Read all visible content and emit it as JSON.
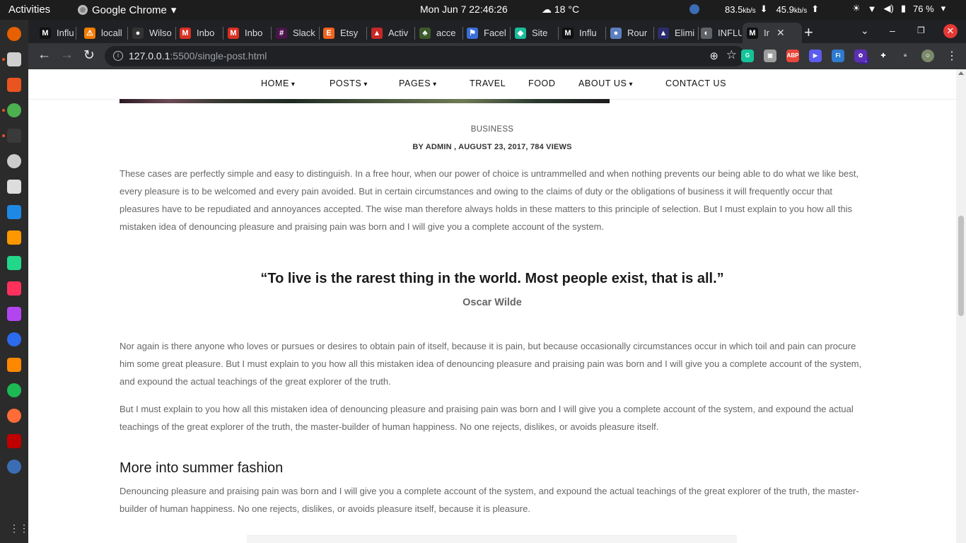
{
  "system_bar": {
    "activities": "Activities",
    "app_name": "Google Chrome",
    "datetime": "Mon Jun 7  22:46:26",
    "weather": "18 °C",
    "down_speed": "83.5",
    "down_unit": "kb/s",
    "up_speed": "45.9",
    "up_unit": "kb/s",
    "battery": "76 %"
  },
  "tabs": [
    {
      "label": "Influ",
      "icon": "medium-icon",
      "color": "#111111",
      "glyph": "M"
    },
    {
      "label": "locall",
      "icon": "xampp-icon",
      "color": "#f57c00",
      "glyph": "⚠"
    },
    {
      "label": "Wilso",
      "icon": "github-icon",
      "color": "#333333",
      "glyph": "●"
    },
    {
      "label": "Inbo",
      "icon": "gmail-icon",
      "color": "#d93025",
      "glyph": "M"
    },
    {
      "label": "Inbo",
      "icon": "gmail-icon",
      "color": "#d93025",
      "glyph": "M"
    },
    {
      "label": "Slack",
      "icon": "slack-icon",
      "color": "#4a154b",
      "glyph": "#"
    },
    {
      "label": "Etsy",
      "icon": "etsy-icon",
      "color": "#f1641e",
      "glyph": "E"
    },
    {
      "label": "Activ",
      "icon": "lock-icon",
      "color": "#c62828",
      "glyph": "▲"
    },
    {
      "label": "acce",
      "icon": "tree-icon",
      "color": "#3b5a2a",
      "glyph": "♣"
    },
    {
      "label": "Facel",
      "icon": "flag-icon",
      "color": "#3b6fd8",
      "glyph": "⚑"
    },
    {
      "label": "Site",
      "icon": "diamond-icon",
      "color": "#1abc9c",
      "glyph": "◆"
    },
    {
      "label": "Influ",
      "icon": "medium-icon",
      "color": "#111111",
      "glyph": "M"
    },
    {
      "label": "Rour",
      "icon": "globe-icon",
      "color": "#5b7fbf",
      "glyph": "●"
    },
    {
      "label": "Elimi",
      "icon": "hat-icon",
      "color": "#2c2c6c",
      "glyph": "▲"
    },
    {
      "label": "INFLU",
      "icon": "globe-icon",
      "color": "#5f6368",
      "glyph": "◐"
    },
    {
      "label": "Ir",
      "icon": "medium-icon",
      "color": "#111111",
      "glyph": "M",
      "active": true
    }
  ],
  "address_bar": {
    "host": "127.0.0.1",
    "path": ":5500/single-post.html"
  },
  "extensions": [
    {
      "name": "grammarly-icon",
      "label": "G",
      "color": "#15c39a"
    },
    {
      "name": "extension-gray-icon",
      "label": "▣",
      "color": "#9e9e9e"
    },
    {
      "name": "adblock-plus-icon",
      "label": "ABP",
      "color": "#e8473b"
    },
    {
      "name": "zoom-icon",
      "label": "▶",
      "color": "#5c5cf0"
    },
    {
      "name": "fi-extension-icon",
      "label": "Fi",
      "color": "#2e7bcf"
    },
    {
      "name": "notification-extension-icon",
      "label": "✿",
      "color": "#5b2fb5"
    },
    {
      "name": "puzzle-icon",
      "label": "✚",
      "color": "#35363a"
    },
    {
      "name": "media-queue-icon",
      "label": "≡",
      "color": "#35363a"
    },
    {
      "name": "profile-avatar-icon",
      "label": "☺",
      "color": "#7a8a6a"
    }
  ],
  "extension_badge": "15",
  "site_nav": [
    {
      "label": "HOME",
      "dropdown": true
    },
    {
      "label": "POSTS",
      "dropdown": true
    },
    {
      "label": "PAGES",
      "dropdown": true
    },
    {
      "label": "TRAVEL",
      "dropdown": false
    },
    {
      "label": "FOOD",
      "dropdown": false
    },
    {
      "label": "ABOUT US",
      "dropdown": true
    },
    {
      "label": "CONTACT US",
      "dropdown": false
    }
  ],
  "post": {
    "category": "BUSINESS",
    "meta": "BY ADMIN , AUGUST 23, 2017, 784 VIEWS",
    "para1": "These cases are perfectly simple and easy to distinguish. In a free hour, when our power of choice is untrammelled and when nothing prevents our being able to do what we like best, every pleasure is to be welcomed and every pain avoided. But in certain circumstances and owing to the claims of duty or the obligations of business it will frequently occur that pleasures have to be repudiated and annoyances accepted. The wise man therefore always holds in these matters to this principle of selection. But I must explain to you how all this mistaken idea of denouncing pleasure and praising pain was born and I will give you a complete account of the system.",
    "quote": "“To live is the rarest thing in the world. Most people exist, that is all.”",
    "quote_author": "Oscar Wilde",
    "para2": "Nor again is there anyone who loves or pursues or desires to obtain pain of itself, because it is pain, but because occasionally circumstances occur in which toil and pain can procure him some great pleasure. But I must explain to you how all this mistaken idea of denouncing pleasure and praising pain was born and I will give you a complete account of the system, and expound the actual teachings of the great explorer of the truth.",
    "para3": "But I must explain to you how all this mistaken idea of denouncing pleasure and praising pain was born and I will give you a complete account of the system, and expound the actual teachings of the great explorer of the truth, the master-builder of human happiness. No one rejects, dislikes, or avoids pleasure itself.",
    "subheading": "More into summer fashion",
    "para4": "Denouncing pleasure and praising pain was born and I will give you a complete account of the system, and expound the actual teachings of the great explorer of the truth, the master-builder of human happiness. No one rejects, dislikes, or avoids pleasure itself, because it is pleasure."
  },
  "dock_apps": [
    {
      "name": "firefox-icon",
      "color": "#e66000"
    },
    {
      "name": "files-icon",
      "color": "#cfcfcf"
    },
    {
      "name": "software-center-icon",
      "color": "#e95420"
    },
    {
      "name": "chrome-icon",
      "color": "#4caf50"
    },
    {
      "name": "terminal-icon",
      "color": "#3a3a3a"
    },
    {
      "name": "obs-icon",
      "color": "#cccccc"
    },
    {
      "name": "screenshot-icon",
      "color": "#dddddd"
    },
    {
      "name": "vscode-icon",
      "color": "#1e88e5"
    },
    {
      "name": "sublime-icon",
      "color": "#ff9800"
    },
    {
      "name": "webstorm-icon",
      "color": "#21d789"
    },
    {
      "name": "intellij-icon",
      "color": "#fe315d"
    },
    {
      "name": "phpstorm-icon",
      "color": "#b345f1"
    },
    {
      "name": "signal-icon",
      "color": "#2c6bed"
    },
    {
      "name": "vlc-icon",
      "color": "#ff8800"
    },
    {
      "name": "spotify-icon",
      "color": "#1db954"
    },
    {
      "name": "postman-icon",
      "color": "#ff6c37"
    },
    {
      "name": "filezilla-icon",
      "color": "#bf0000"
    },
    {
      "name": "qbittorrent-icon",
      "color": "#3b6db5"
    }
  ]
}
